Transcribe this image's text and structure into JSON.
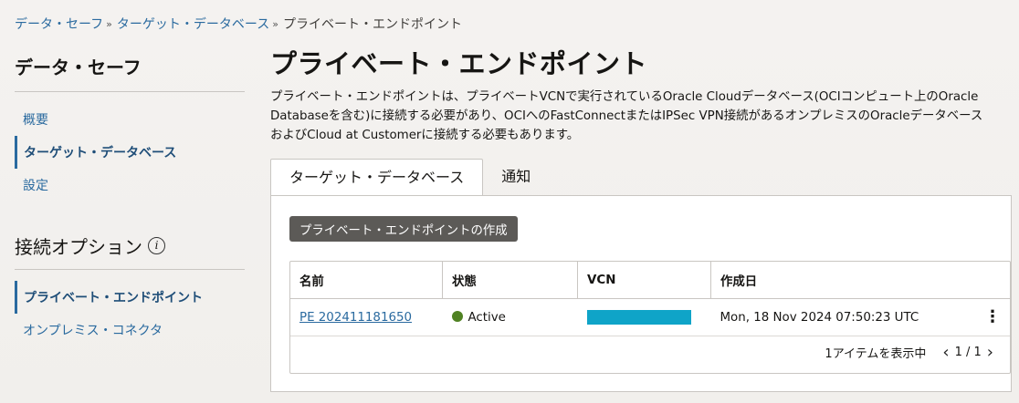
{
  "breadcrumb": {
    "items": [
      "データ・セーフ",
      "ターゲット・データベース"
    ],
    "current": "プライベート・エンドポイント",
    "separator": "»"
  },
  "sidebar": {
    "title": "データ・セーフ",
    "items": [
      {
        "label": "概要"
      },
      {
        "label": "ターゲット・データベース",
        "active": true
      },
      {
        "label": "設定"
      }
    ],
    "options_title": "接続オプション",
    "options_items": [
      {
        "label": "プライベート・エンドポイント",
        "active": true
      },
      {
        "label": "オンプレミス・コネクタ"
      }
    ]
  },
  "main": {
    "title": "プライベート・エンドポイント",
    "description_lines": [
      "プライベート・エンドポイントは、プライベートVCNで実行されているOracle Cloudデータベース(OCIコンピュート上のOracle",
      "Databaseを含む)に接続する必要があり、OCIへのFastConnectまたはIPSec VPN接続があるオンプレミスのOracleデータベース",
      "およびCloud at Customerに接続する必要もあります。"
    ],
    "tabs": [
      {
        "label": "ターゲット・データベース",
        "active": true
      },
      {
        "label": "通知"
      }
    ],
    "create_button": "プライベート・エンドポイントの作成",
    "table": {
      "headers": [
        "名前",
        "状態",
        "VCN",
        "作成日"
      ],
      "rows": [
        {
          "name": "PE 202411181650",
          "status": "Active",
          "created": "Mon, 18 Nov 2024 07:50:23 UTC"
        }
      ],
      "footer_text": "1アイテムを表示中",
      "page": "1 / 1"
    }
  },
  "colors": {
    "link": "#2a6a9f",
    "status_active": "#508223",
    "vcn_redaction": "#0fa4c8",
    "button_bg": "#5c5a57"
  },
  "icons": {
    "info": "info-icon",
    "row_actions": "kebab-menu-icon",
    "prev_page": "chevron-left-icon",
    "next_page": "chevron-right-icon"
  }
}
